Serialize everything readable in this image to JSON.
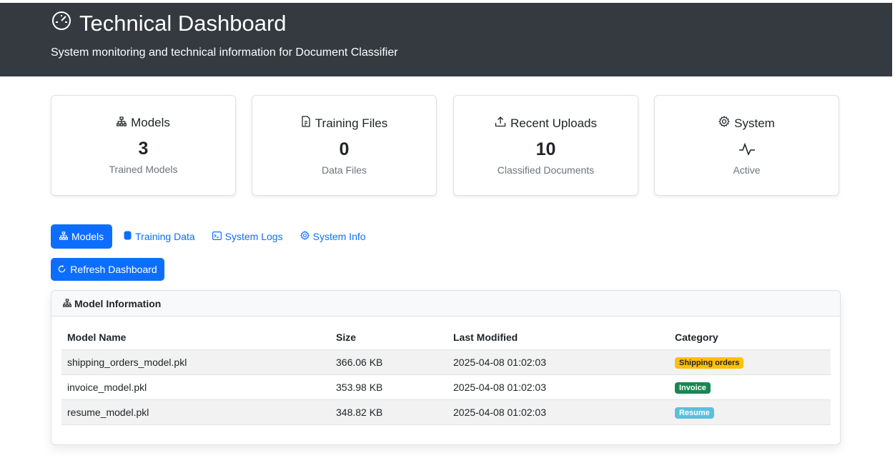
{
  "header": {
    "title": "Technical Dashboard",
    "subtitle": "System monitoring and technical information for Document Classifier",
    "icon": "speedometer-icon"
  },
  "cards": [
    {
      "title": "Models",
      "icon": "diagram-icon",
      "value": "3",
      "caption": "Trained Models"
    },
    {
      "title": "Training Files",
      "icon": "file-text-icon",
      "value": "0",
      "caption": "Data Files"
    },
    {
      "title": "Recent Uploads",
      "icon": "upload-icon",
      "value": "10",
      "caption": "Classified Documents"
    },
    {
      "title": "System",
      "icon": "gear-icon",
      "value_icon": "activity-icon",
      "caption": "Active"
    }
  ],
  "tabs": [
    {
      "label": "Models",
      "icon": "diagram-icon",
      "active": true
    },
    {
      "label": "Training Data",
      "icon": "database-icon",
      "active": false
    },
    {
      "label": "System Logs",
      "icon": "terminal-icon",
      "active": false
    },
    {
      "label": "System Info",
      "icon": "gear-icon",
      "active": false
    }
  ],
  "refresh_label": "Refresh Dashboard",
  "model_panel": {
    "title": "Model Information",
    "columns": [
      "Model Name",
      "Size",
      "Last Modified",
      "Category"
    ],
    "rows": [
      {
        "name": "shipping_orders_model.pkl",
        "size": "366.06 KB",
        "modified": "2025-04-08 01:02:03",
        "category": "Shipping orders",
        "badge_bg": "#ffc107",
        "badge_fg": "#212529"
      },
      {
        "name": "invoice_model.pkl",
        "size": "353.98 KB",
        "modified": "2025-04-08 01:02:03",
        "category": "Invoice",
        "badge_bg": "#198754",
        "badge_fg": "#ffffff"
      },
      {
        "name": "resume_model.pkl",
        "size": "348.82 KB",
        "modified": "2025-04-08 01:02:03",
        "category": "Resume",
        "badge_bg": "#5bc0de",
        "badge_fg": "#ffffff"
      }
    ]
  },
  "colors": {
    "primary": "#0d6efd",
    "header_bg": "#343a40"
  }
}
